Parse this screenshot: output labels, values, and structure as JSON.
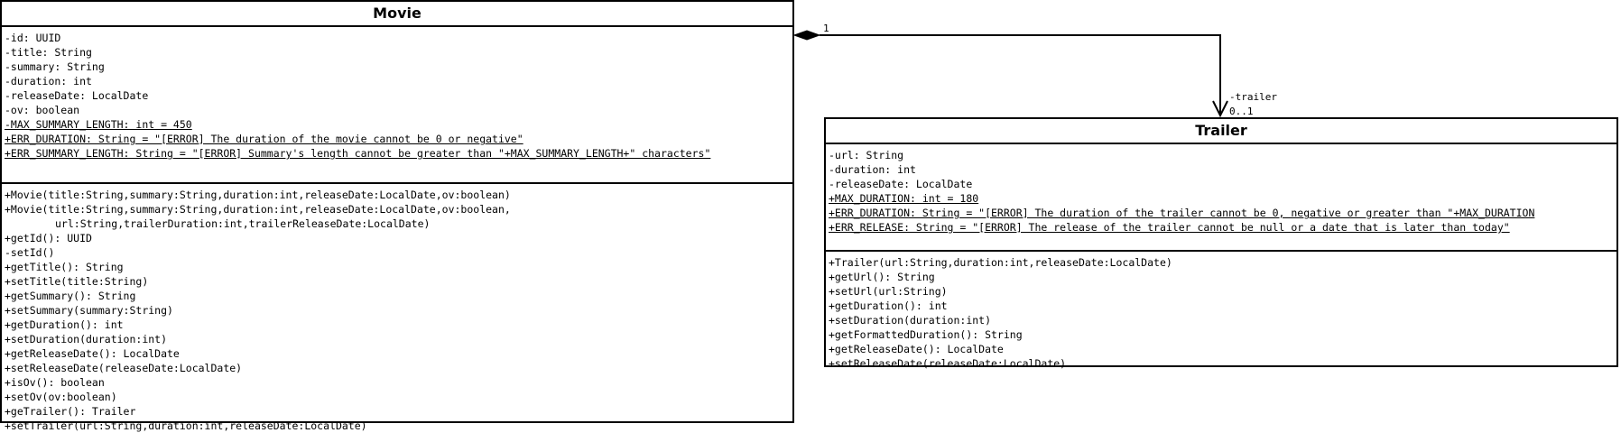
{
  "movie": {
    "name": "Movie",
    "attributes": [
      {
        "text": "-id: UUID",
        "static": false
      },
      {
        "text": "-title: String",
        "static": false
      },
      {
        "text": "-summary: String",
        "static": false
      },
      {
        "text": "-duration: int",
        "static": false
      },
      {
        "text": "-releaseDate: LocalDate",
        "static": false
      },
      {
        "text": "-ov: boolean",
        "static": false
      },
      {
        "text": "-MAX_SUMMARY_LENGTH: int = 450",
        "static": true
      },
      {
        "text": "+ERR_DURATION: String = \"[ERROR] The duration of the movie cannot be 0 or negative\"",
        "static": true
      },
      {
        "text": "+ERR_SUMMARY_LENGTH: String = \"[ERROR] Summary's length cannot be greater than \"+MAX_SUMMARY_LENGTH+\" characters\"",
        "static": true
      }
    ],
    "methods": [
      {
        "text": "+Movie(title:String,summary:String,duration:int,releaseDate:LocalDate,ov:boolean)",
        "indent": false
      },
      {
        "text": "+Movie(title:String,summary:String,duration:int,releaseDate:LocalDate,ov:boolean,",
        "indent": false
      },
      {
        "text": "url:String,trailerDuration:int,trailerReleaseDate:LocalDate)",
        "indent": true
      },
      {
        "text": "+getId(): UUID",
        "indent": false
      },
      {
        "text": "-setId()",
        "indent": false
      },
      {
        "text": "+getTitle(): String",
        "indent": false
      },
      {
        "text": "+setTitle(title:String)",
        "indent": false
      },
      {
        "text": "+getSummary(): String",
        "indent": false
      },
      {
        "text": "+setSummary(summary:String)",
        "indent": false
      },
      {
        "text": "+getDuration(): int",
        "indent": false
      },
      {
        "text": "+setDuration(duration:int)",
        "indent": false
      },
      {
        "text": "+getReleaseDate(): LocalDate",
        "indent": false
      },
      {
        "text": "+setReleaseDate(releaseDate:LocalDate)",
        "indent": false
      },
      {
        "text": "+isOv(): boolean",
        "indent": false
      },
      {
        "text": "+setOv(ov:boolean)",
        "indent": false
      },
      {
        "text": "+geTrailer(): Trailer",
        "indent": false
      },
      {
        "text": "+setTrailer(url:String,duration:int,releaseDate:LocalDate)",
        "indent": false
      }
    ]
  },
  "trailer": {
    "name": "Trailer",
    "attributes": [
      {
        "text": "-url: String",
        "static": false
      },
      {
        "text": "-duration: int",
        "static": false
      },
      {
        "text": "-releaseDate: LocalDate",
        "static": false
      },
      {
        "text": "+MAX_DURATION: int = 180",
        "static": true
      },
      {
        "text": "+ERR_DURATION: String = \"[ERROR] The duration of the trailer cannot be 0, negative or greater than \"+MAX_DURATION",
        "static": true
      },
      {
        "text": "+ERR_RELEASE: String = \"[ERROR] The release of the trailer cannot be null or a date that is later than today\"",
        "static": true
      }
    ],
    "methods": [
      {
        "text": "+Trailer(url:String,duration:int,releaseDate:LocalDate)",
        "indent": false
      },
      {
        "text": "+getUrl(): String",
        "indent": false
      },
      {
        "text": "+setUrl(url:String)",
        "indent": false
      },
      {
        "text": "+getDuration(): int",
        "indent": false
      },
      {
        "text": "+setDuration(duration:int)",
        "indent": false
      },
      {
        "text": "+getFormattedDuration(): String",
        "indent": false
      },
      {
        "text": "+getReleaseDate(): LocalDate",
        "indent": false
      },
      {
        "text": "+setReleaseDate(releaseDate:LocalDate)",
        "indent": false
      }
    ]
  },
  "association": {
    "source_multiplicity": "1",
    "role": "-trailer",
    "target_multiplicity": "0..1",
    "kind": "composition"
  }
}
